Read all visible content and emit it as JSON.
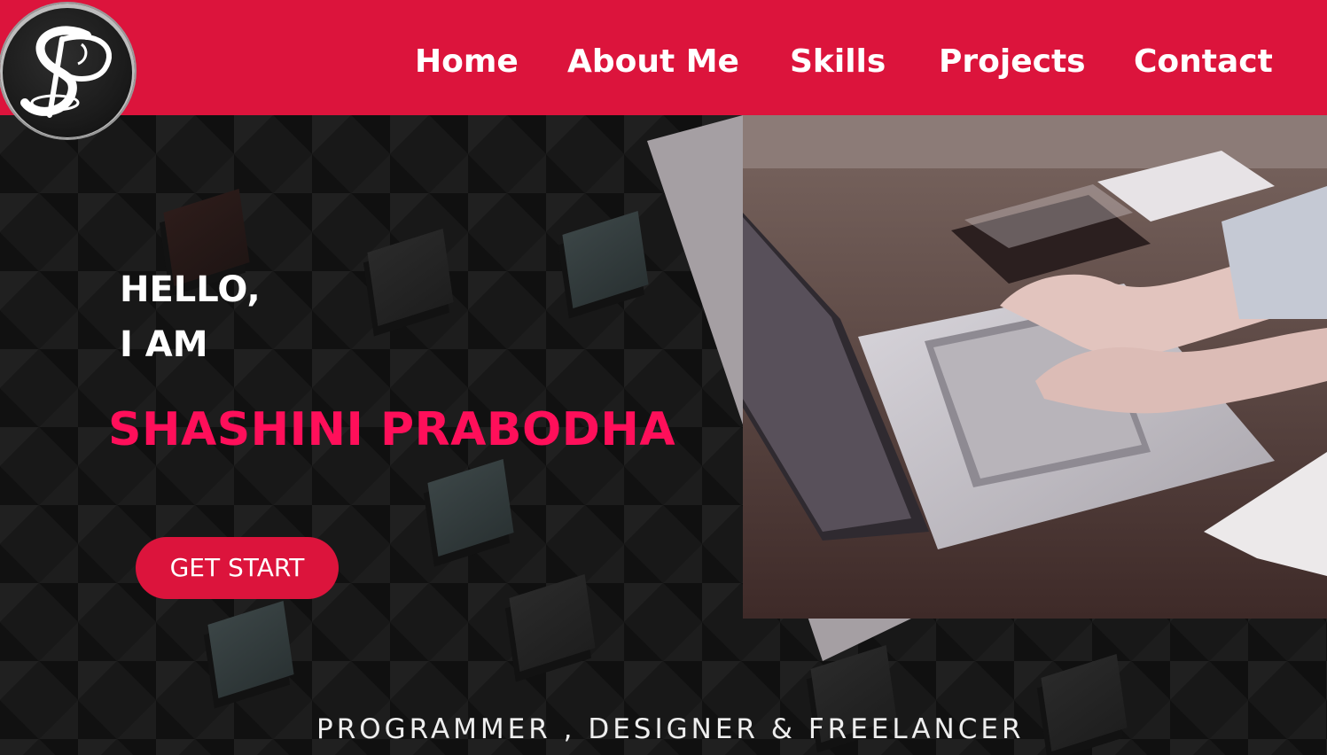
{
  "logo": {
    "text": "SP"
  },
  "nav": {
    "items": [
      {
        "label": "Home"
      },
      {
        "label": "About Me"
      },
      {
        "label": "Skills"
      },
      {
        "label": "Projects"
      },
      {
        "label": "Contact"
      }
    ]
  },
  "hero": {
    "greeting_line1": "HELLO,",
    "greeting_line2": "I AM",
    "name": "SHASHINI PRABODHA",
    "cta_label": "GET START",
    "tagline": "PROGRAMMER , DESIGNER & FREELANCER",
    "photo_icon": "laptop-typing-photo"
  },
  "colors": {
    "brand": "#dc143c",
    "name_accent": "#ff0f5a",
    "hero_bg": "#181818",
    "panel_gray": "#a59fa3"
  }
}
